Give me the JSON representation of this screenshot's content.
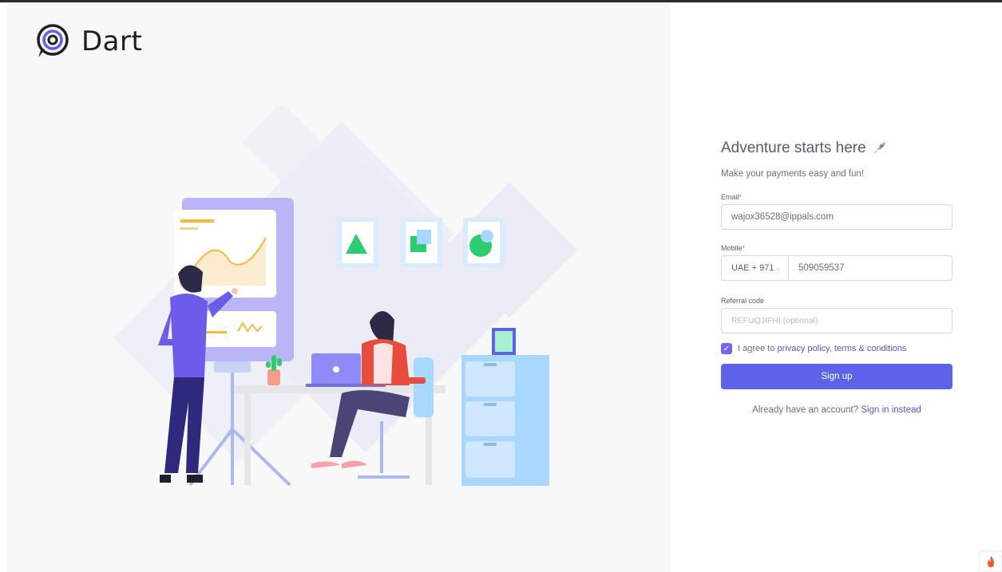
{
  "brand": {
    "name": "Dart"
  },
  "form": {
    "title": "Adventure starts here",
    "title_icon": "rocket-icon",
    "subtitle": "Make your payments easy and fun!",
    "email_label": "Email",
    "email_value": "wajox36528@ippals.com",
    "mobile_label": "Mobile",
    "country_code": "UAE + 971",
    "mobile_value": "509059537",
    "referral_label": "Referral code",
    "referral_placeholder": "REFUQJIFHI (optional)",
    "agree_prefix": "I agree to",
    "agree_link": "privacy policy, terms & conditions",
    "submit_label": "Sign up",
    "already_text": "Already have an account?",
    "signin_link": "Sign in instead",
    "required_mark": "*"
  },
  "colors": {
    "accent": "#5c63e6",
    "checkbox": "#7367f0",
    "required": "#ea5455"
  }
}
